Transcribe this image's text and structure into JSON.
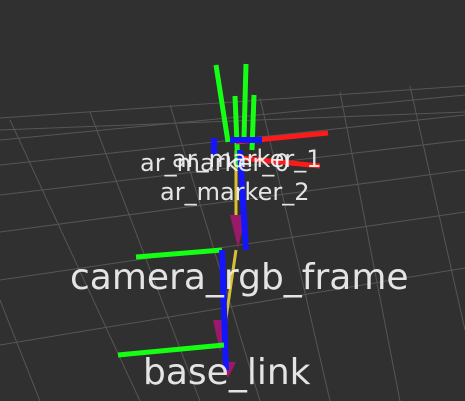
{
  "colors": {
    "background": "#303030",
    "grid": "#5a5a5a",
    "axis_x": "#ff1a1a",
    "axis_y": "#14ff14",
    "axis_z": "#1414ff",
    "tf_arrow": "#9a1a6a",
    "tf_link": "#d8c030",
    "label": "#f4f4f4"
  },
  "frames": [
    {
      "id": "ar_marker_0",
      "label": "ar_marker_0"
    },
    {
      "id": "ar_marker_1",
      "label": "ar_marker_1"
    },
    {
      "id": "ar_marker_2",
      "label": "ar_marker_2"
    },
    {
      "id": "camera_rgb_frame",
      "label": "camera_rgb_frame"
    },
    {
      "id": "base_link",
      "label": "base_link"
    }
  ]
}
